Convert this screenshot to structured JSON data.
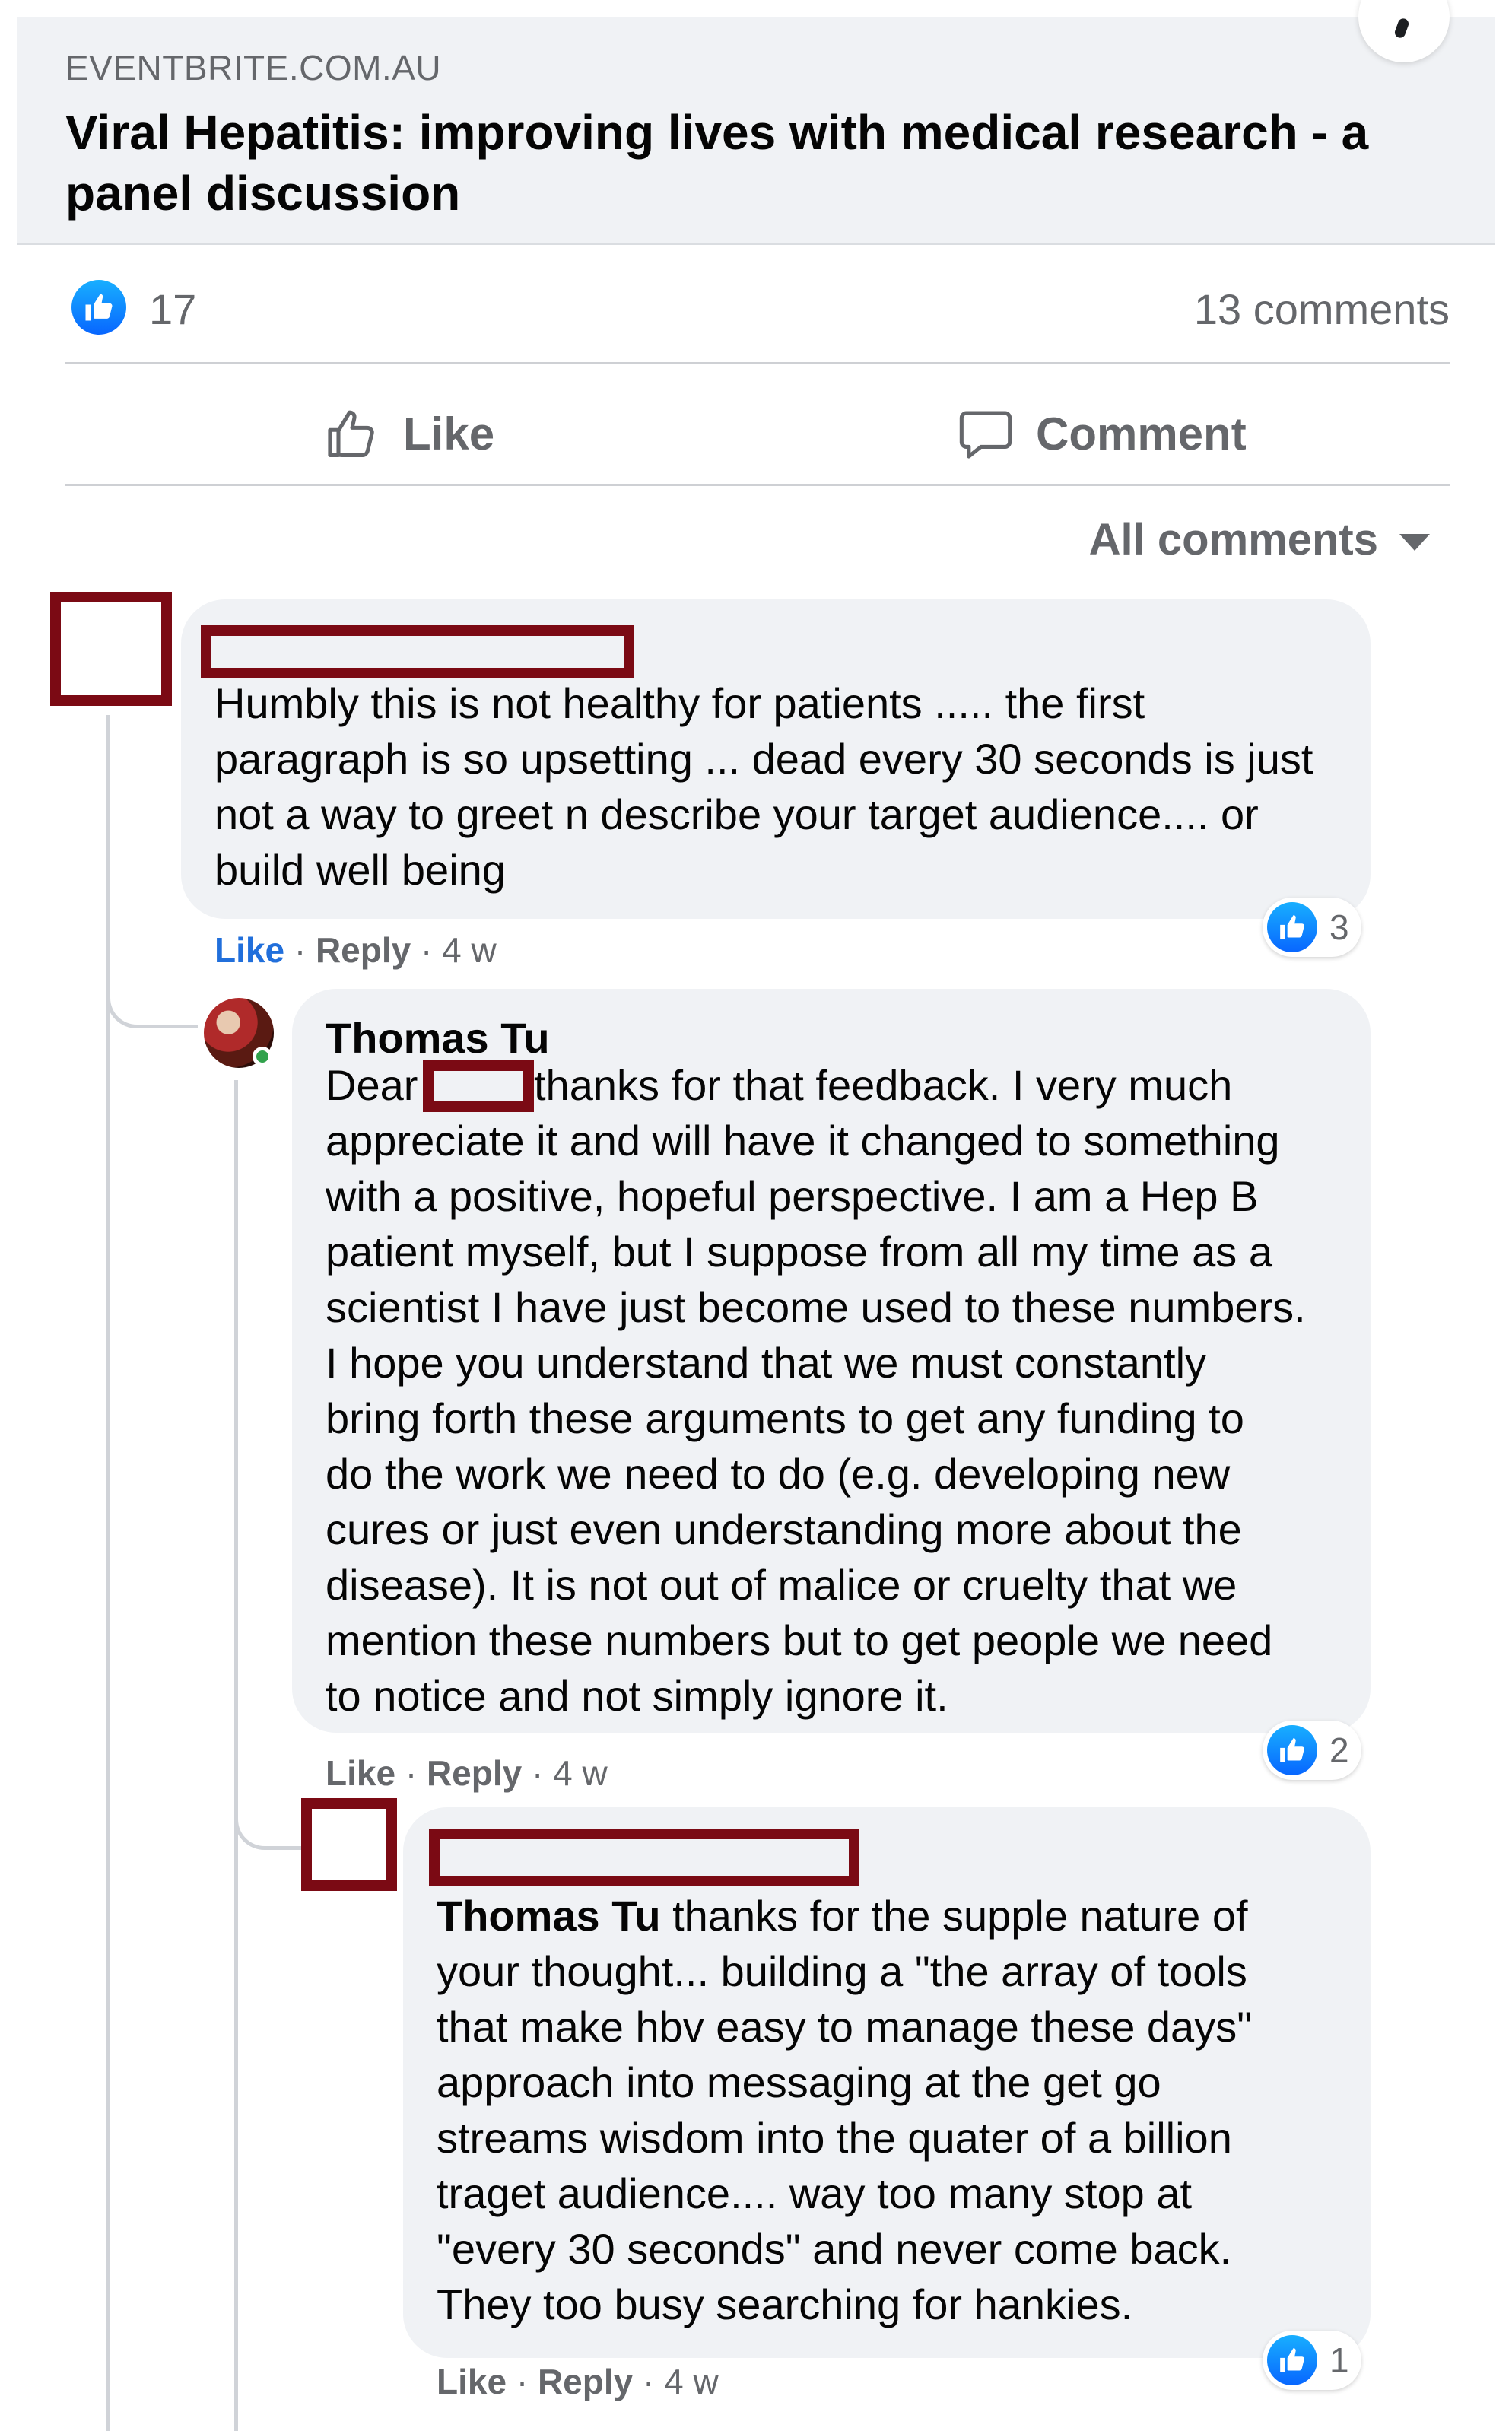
{
  "preview": {
    "domain": "EVENTBRITE.COM.AU",
    "title": "Viral Hepatitis: improving lives with medical research - a panel discussion"
  },
  "summary": {
    "like_count": "17",
    "comments_count": "13 comments"
  },
  "actions": {
    "like_label": "Like",
    "comment_label": "Comment"
  },
  "filter": {
    "label": "All comments"
  },
  "comments": [
    {
      "text": "Humbly this is not healthy for patients ..... the first\nparagraph is so upsetting ... dead every 30 seconds is just\nnot a way to greet n describe your target audience.... or\nbuild well being",
      "like": "Like",
      "reply": "Reply",
      "time": "4 w",
      "reactions": "3"
    },
    {
      "author": "Thomas Tu",
      "text_prefix": "Dear",
      "text": "thanks for that feedback. I very much\nappreciate it and will have it changed to something\nwith a positive, hopeful perspective. I am a Hep B\npatient myself, but I suppose from all my time as a\nscientist I have just become used to these numbers.\nI hope you understand that we must constantly\nbring forth these arguments to get any funding to\ndo the work we need to do (e.g. developing new\ncures or just even understanding more about the\ndisease). It is not out of malice or cruelty that we\nmention these numbers but to get people we need\nto notice and not simply ignore it.",
      "like": "Like",
      "reply": "Reply",
      "time": "4 w",
      "reactions": "2"
    },
    {
      "mention": "Thomas Tu",
      "text": " thanks for the supple nature of\nyour thought... building a \"the array of tools\nthat make hbv easy to manage these days\"\napproach into messaging at the get go\nstreams wisdom into the quater of a billion\ntraget audience.... way too many stop at\n\"every 30 seconds\" and never come back.\nThey too busy searching for hankies.",
      "like": "Like",
      "reply": "Reply",
      "time": "4 w",
      "reactions": "1"
    }
  ],
  "colors": {
    "facebook_blue": "#0866ff",
    "redaction": "#7b0a14",
    "bubble": "#f0f2f5"
  }
}
